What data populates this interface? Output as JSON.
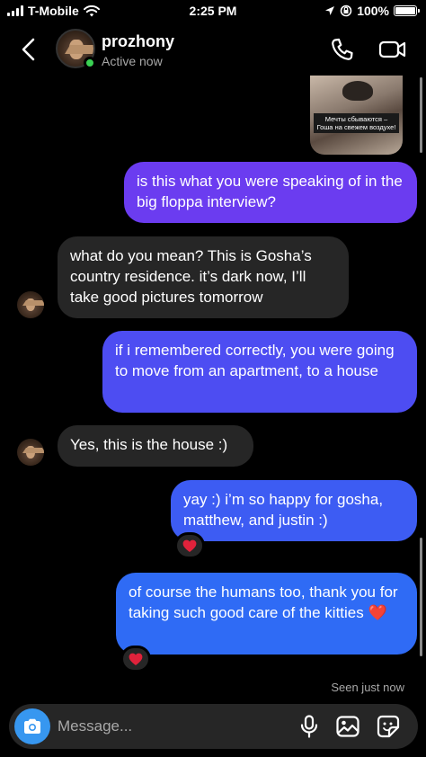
{
  "status_bar": {
    "carrier": "T-Mobile",
    "time": "2:25 PM",
    "battery": "100%",
    "battery_level": 1.0
  },
  "header": {
    "name": "prozhony",
    "status": "Active now"
  },
  "shared_post": {
    "caption": "Мечты сбываются – Гоша на свежем воздухе!"
  },
  "messages": [
    {
      "from": "me",
      "text": "is this what you were speaking of in the big floppa interview?"
    },
    {
      "from": "them",
      "text": "what do you mean? This is Gosha’s country residence. it’s dark now, I’ll take good pictures tomorrow"
    },
    {
      "from": "me",
      "text": "if i remembered correctly, you were going to move from an apartment, to a house"
    },
    {
      "from": "them",
      "text": "Yes, this is the house :)"
    },
    {
      "from": "me",
      "text": "yay :) i’m so happy for gosha, matthew, and justin :)",
      "reaction": "❤️"
    },
    {
      "from": "me",
      "text": "of course the humans too, thank you for taking such good care of the kitties ❤️",
      "reaction": "❤️"
    }
  ],
  "seen": "Seen just now",
  "composer": {
    "placeholder": "Message..."
  },
  "colors": {
    "bubble_purple": "#6b3cf0",
    "bubble_blue": "#2f6bf5",
    "received": "#262626",
    "online": "#3ad153",
    "camera": "#3797f0"
  },
  "icons": [
    "back-arrow-icon",
    "phone-icon",
    "video-camera-icon",
    "camera-icon",
    "microphone-icon",
    "gallery-icon",
    "sticker-icon",
    "heart-icon",
    "wifi-icon",
    "location-icon",
    "orientation-lock-icon"
  ]
}
